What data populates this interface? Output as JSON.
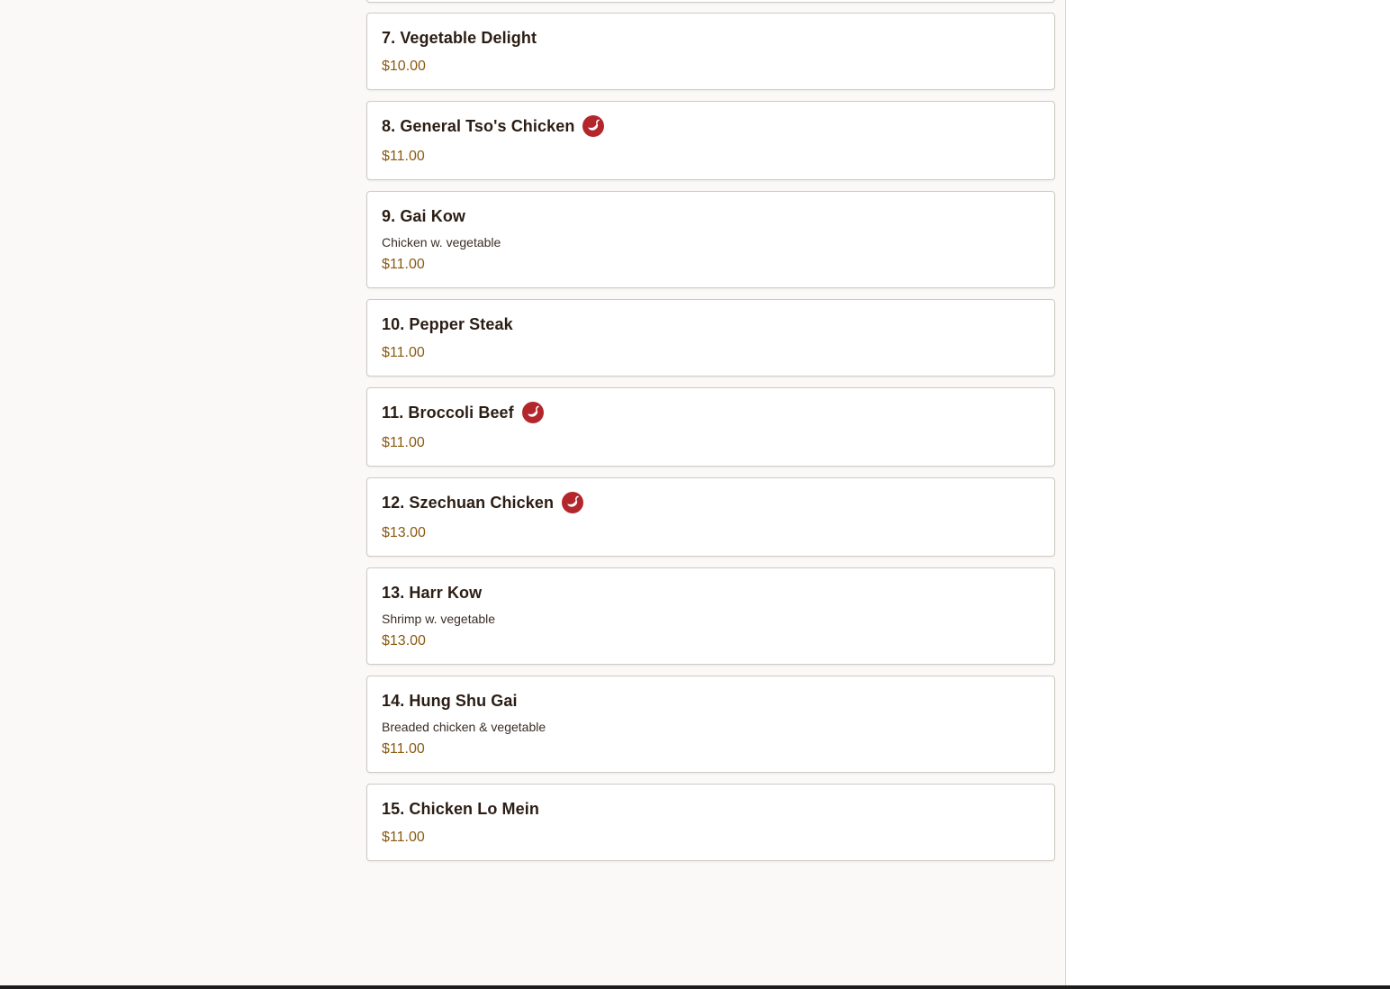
{
  "menu": {
    "items": [
      {
        "name": "7. Vegetable Delight",
        "description": "",
        "price": "$10.00",
        "spicy": false
      },
      {
        "name": "8. General Tso's Chicken",
        "description": "",
        "price": "$11.00",
        "spicy": true
      },
      {
        "name": "9. Gai Kow",
        "description": "Chicken w. vegetable",
        "price": "$11.00",
        "spicy": false
      },
      {
        "name": "10. Pepper Steak",
        "description": "",
        "price": "$11.00",
        "spicy": false
      },
      {
        "name": "11. Broccoli Beef",
        "description": "",
        "price": "$11.00",
        "spicy": true
      },
      {
        "name": "12. Szechuan Chicken",
        "description": "",
        "price": "$13.00",
        "spicy": true
      },
      {
        "name": "13. Harr Kow",
        "description": "Shrimp w. vegetable",
        "price": "$13.00",
        "spicy": false
      },
      {
        "name": "14. Hung Shu Gai",
        "description": "Breaded chicken & vegetable",
        "price": "$11.00",
        "spicy": false
      },
      {
        "name": "15. Chicken Lo Mein",
        "description": "",
        "price": "$11.00",
        "spicy": false
      }
    ]
  },
  "icons": {
    "spicy": "chili-pepper-icon"
  },
  "colors": {
    "spicy_badge": "#b3262b",
    "price": "#8a5a12",
    "item_name": "#2b1d14"
  }
}
